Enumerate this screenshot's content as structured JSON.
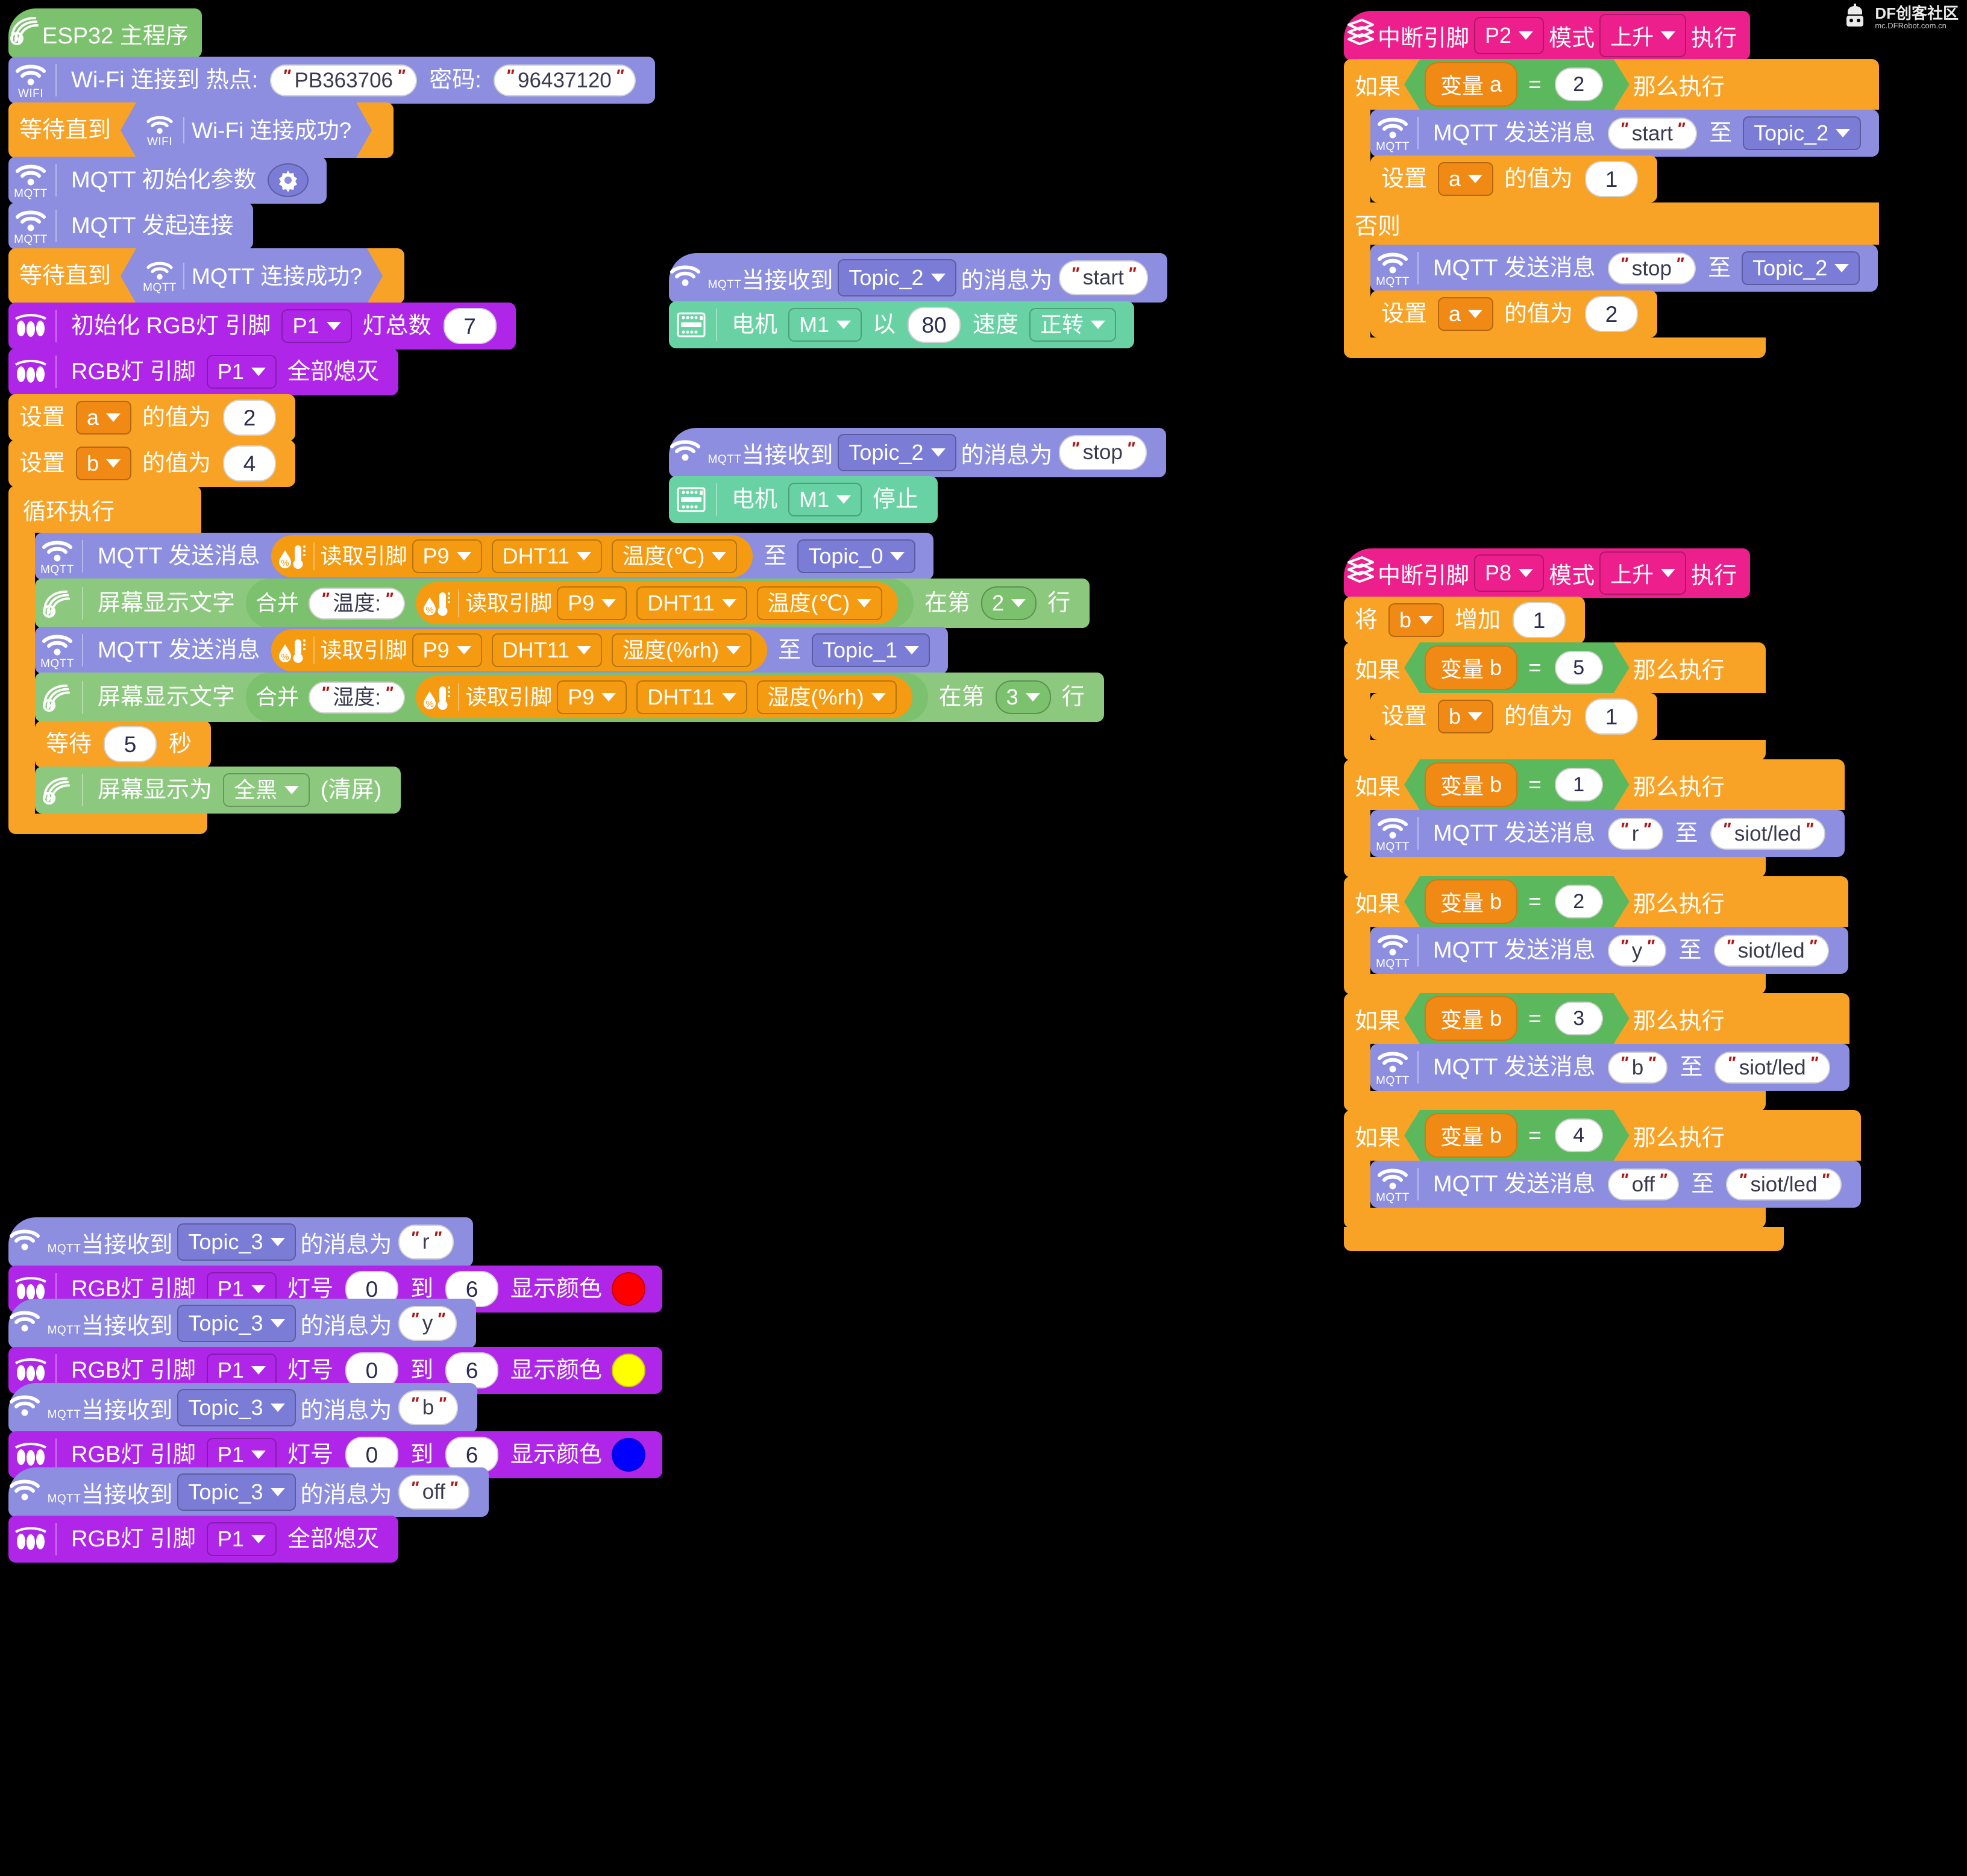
{
  "watermark": {
    "name": "DF创客社区",
    "url": "mc.DFRobot.com.cn"
  },
  "labels": {
    "wifi_icon_text": "WIFI",
    "mqtt_icon_text": "MQTT",
    "equals": "=",
    "quote": "\"",
    "esp32_main": "ESP32 主程序",
    "wifi_connect": "Wi-Fi 连接到 热点:",
    "password": "密码:",
    "wait_until": "等待直到",
    "wifi_connected_q": "Wi-Fi 连接成功?",
    "mqtt_init": "MQTT 初始化参数",
    "mqtt_connect": "MQTT 发起连接",
    "mqtt_connected_q": "MQTT 连接成功?",
    "rgb_init": "初始化 RGB灯 引脚",
    "rgb_total": "灯总数",
    "rgb_pin": "RGB灯 引脚",
    "rgb_all_off": "全部熄灭",
    "set_var": "设置",
    "set_value_to": "的值为",
    "forever": "循环执行",
    "mqtt_publish": "MQTT 发送消息",
    "read_pin": "读取引脚",
    "to": "至",
    "screen_text": "屏幕显示文字",
    "join": "合并",
    "at_line": "在第",
    "line": "行",
    "wait": "等待",
    "seconds": "秒",
    "screen_show_as": "屏幕显示为",
    "clear_screen": "(清屏)",
    "on_message": "当接收到",
    "message_is": "的消息为",
    "led_no": "灯号",
    "led_to": "到",
    "show_color": "显示颜色",
    "motor": "电机",
    "with": "以",
    "speed": "速度",
    "motor_stop": "停止",
    "interrupt_pin": "中断引脚",
    "mode": "模式",
    "do": "执行",
    "if": "如果",
    "then": "那么执行",
    "else": "否则",
    "variable": "变量",
    "change_by_a": "将",
    "change_by_b": "增加"
  },
  "colors": {
    "wifi_block": "#8d8ee0",
    "control_block": "#f9a326",
    "rgb_block": "#b026e8",
    "display_block": "#8cc97f",
    "sensor_block": "#f59b11",
    "motor_block": "#69d2a5",
    "event_block": "#ec1f8c",
    "bool_block": "#5cb85c",
    "variable_block": "#f08a14",
    "red": "#ff0000",
    "yellow": "#ffff00",
    "blue": "#0000ff"
  },
  "main_program": {
    "title": "ESP32 主程序",
    "wifi": {
      "ssid": "PB363706",
      "password": "96437120"
    },
    "rgb": {
      "pin": "P1",
      "count": "7"
    },
    "variables": [
      {
        "name": "a",
        "value": "2"
      },
      {
        "name": "b",
        "value": "4"
      }
    ],
    "loop": {
      "publish_temp": {
        "pin": "P9",
        "sensor": "DHT11",
        "measure": "温度(℃)",
        "topic": "Topic_0"
      },
      "display_temp": {
        "prefix": "温度:",
        "pin": "P9",
        "sensor": "DHT11",
        "measure": "温度(℃)",
        "line": "2"
      },
      "publish_humi": {
        "pin": "P9",
        "sensor": "DHT11",
        "measure": "湿度(%rh)",
        "topic": "Topic_1"
      },
      "display_humi": {
        "prefix": "湿度:",
        "pin": "P9",
        "sensor": "DHT11",
        "measure": "湿度(%rh)",
        "line": "3"
      },
      "wait_seconds": "5",
      "screen_mode": "全黑"
    }
  },
  "motor_handlers": [
    {
      "topic": "Topic_2",
      "message": "start",
      "action": {
        "type": "run",
        "motor": "M1",
        "speed": "80",
        "direction": "正转"
      }
    },
    {
      "topic": "Topic_2",
      "message": "stop",
      "action": {
        "type": "stop",
        "motor": "M1"
      }
    }
  ],
  "rgb_handlers": [
    {
      "topic": "Topic_3",
      "message": "r",
      "pin": "P1",
      "from": "0",
      "to": "6",
      "color": "#ff0000",
      "all_off": false
    },
    {
      "topic": "Topic_3",
      "message": "y",
      "pin": "P1",
      "from": "0",
      "to": "6",
      "color": "#ffff00",
      "all_off": false
    },
    {
      "topic": "Topic_3",
      "message": "b",
      "pin": "P1",
      "from": "0",
      "to": "6",
      "color": "#0000ff",
      "all_off": false
    },
    {
      "topic": "Topic_3",
      "message": "off",
      "pin": "P1",
      "all_off": true
    }
  ],
  "interrupt_p2": {
    "pin": "P2",
    "mode": "上升",
    "condition": {
      "variable": "a",
      "operator": "=",
      "value": "2"
    },
    "then": [
      {
        "kind": "publish",
        "message": "start",
        "topic": "Topic_2"
      },
      {
        "kind": "set",
        "variable": "a",
        "value": "1"
      }
    ],
    "else": [
      {
        "kind": "publish",
        "message": "stop",
        "topic": "Topic_2"
      },
      {
        "kind": "set",
        "variable": "a",
        "value": "2"
      }
    ]
  },
  "interrupt_p8": {
    "pin": "P8",
    "mode": "上升",
    "increment": {
      "variable": "b",
      "amount": "1"
    },
    "branches": [
      {
        "variable": "b",
        "operator": "=",
        "value": "5",
        "action": {
          "kind": "set",
          "variable": "b",
          "value": "1"
        }
      },
      {
        "variable": "b",
        "operator": "=",
        "value": "1",
        "action": {
          "kind": "publish",
          "message": "r",
          "topic": "siot/led"
        }
      },
      {
        "variable": "b",
        "operator": "=",
        "value": "2",
        "action": {
          "kind": "publish",
          "message": "y",
          "topic": "siot/led"
        }
      },
      {
        "variable": "b",
        "operator": "=",
        "value": "3",
        "action": {
          "kind": "publish",
          "message": "b",
          "topic": "siot/led"
        }
      },
      {
        "variable": "b",
        "operator": "=",
        "value": "4",
        "action": {
          "kind": "publish",
          "message": "off",
          "topic": "siot/led"
        }
      }
    ]
  }
}
